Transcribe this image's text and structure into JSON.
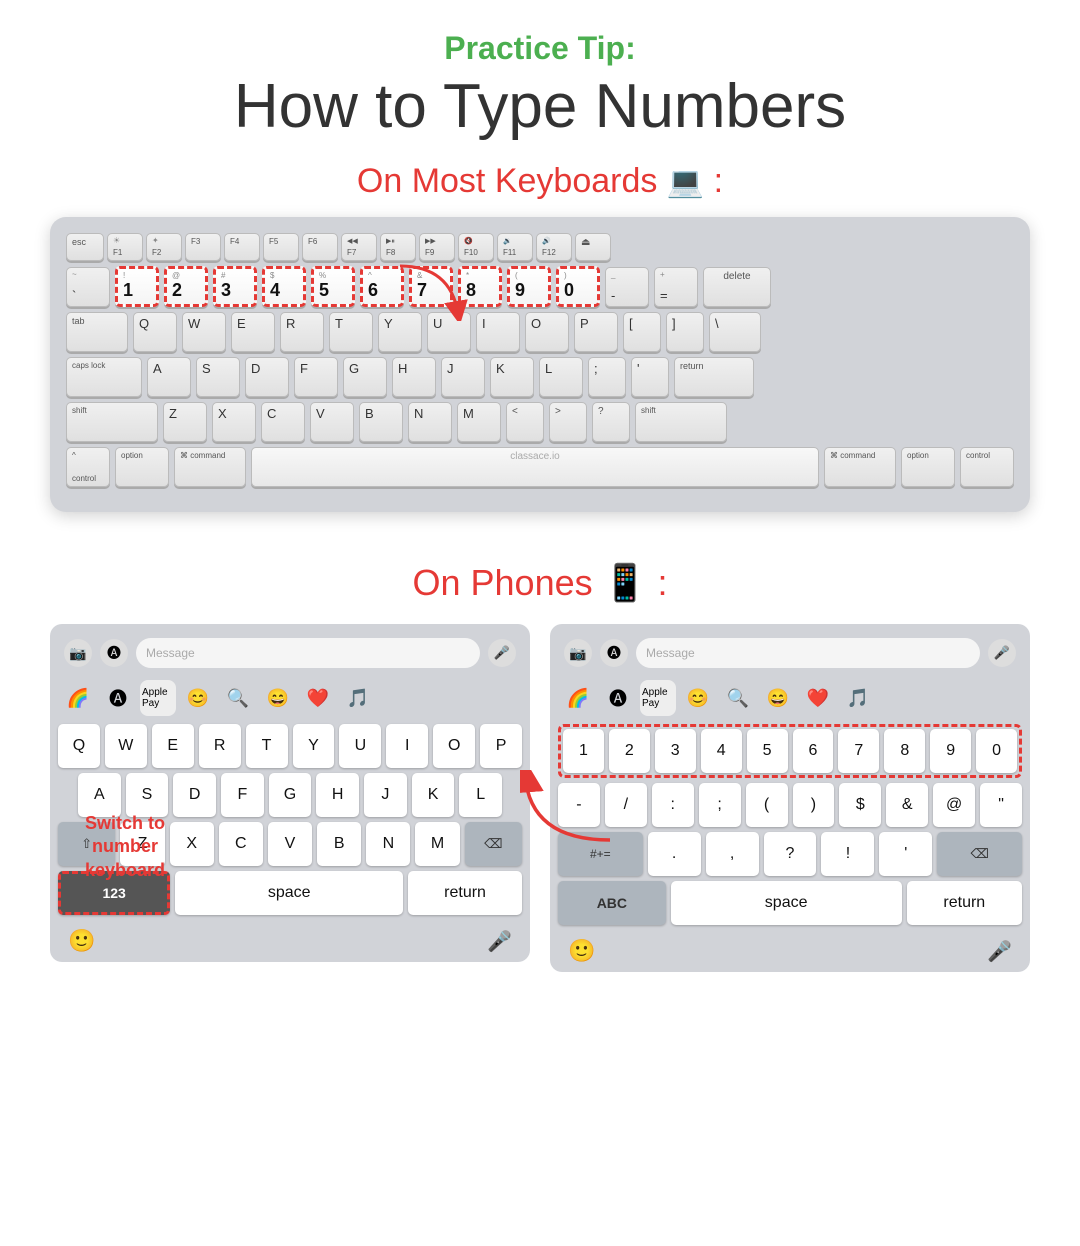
{
  "header": {
    "practice_tip": "Practice Tip:",
    "main_title": "How to Type Numbers"
  },
  "keyboard_section": {
    "label": "On Most Keyboards",
    "emoji": "💻",
    "colon": ":",
    "watermark": "classace.io",
    "fn_keys": [
      "esc",
      "F1",
      "F2",
      "F3",
      "F4",
      "F5",
      "F6",
      "F7",
      "F8",
      "F9",
      "F10",
      "F11",
      "F12",
      ""
    ],
    "number_row": [
      "~\n`",
      "!\n1",
      "@\n2",
      "#\n3",
      "$\n4",
      "%\n5",
      "^\n6",
      "&\n7",
      "*\n8",
      "(\n9",
      ")\n0",
      "-\n_",
      "+\n=",
      "delete"
    ],
    "number_row_labels": [
      "1",
      "2",
      "3",
      "4",
      "5",
      "6",
      "7",
      "8",
      "9",
      "0"
    ],
    "qwerty_row": [
      "tab",
      "Q",
      "W",
      "E",
      "R",
      "T",
      "Y",
      "U",
      "I",
      "O",
      "P",
      "[",
      "]",
      "\\"
    ],
    "asdf_row": [
      "caps lock",
      "A",
      "S",
      "D",
      "F",
      "G",
      "H",
      "J",
      "K",
      "L",
      ";",
      "'",
      "return"
    ],
    "zxcv_row": [
      "shift",
      "Z",
      "X",
      "C",
      "V",
      "B",
      "N",
      "M",
      "<",
      ">",
      "?",
      "shift"
    ],
    "bottom_row": [
      "control",
      "option",
      "command",
      "",
      "command",
      "option",
      "control"
    ]
  },
  "phone_section": {
    "label": "On Phones",
    "emoji": "📱",
    "colon": ":",
    "left_keyboard": {
      "emoji_row": [
        "🌈",
        "🅐",
        "Apple Pay",
        "😊",
        "🔍",
        "😄",
        "❤️",
        "🎵"
      ],
      "qwerty": [
        "Q",
        "W",
        "E",
        "R",
        "T",
        "Y",
        "U",
        "I",
        "O",
        "P"
      ],
      "asdf": [
        "A",
        "S",
        "D",
        "F",
        "G",
        "H",
        "J",
        "K",
        "L"
      ],
      "zxcv": [
        "Z",
        "X",
        "C",
        "V",
        "B",
        "N",
        "M"
      ],
      "bottom": [
        "123",
        "space",
        "return"
      ],
      "num_key_label": "123"
    },
    "right_keyboard": {
      "emoji_row": [
        "🌈",
        "🅐",
        "Apple Pay",
        "😊",
        "🔍",
        "😄",
        "❤️",
        "🎵"
      ],
      "number_row": [
        "1",
        "2",
        "3",
        "4",
        "5",
        "6",
        "7",
        "8",
        "9",
        "0"
      ],
      "symbol_row": [
        "-",
        "/",
        ":",
        ";",
        "(",
        ")",
        "$",
        "&",
        "@",
        "\""
      ],
      "more_row": [
        "#+=",
        ".",
        ",",
        "?",
        "!",
        "'",
        "⌫"
      ],
      "bottom": [
        "ABC",
        "space",
        "return"
      ]
    },
    "switch_label": "Switch to number\nkeyboard"
  }
}
